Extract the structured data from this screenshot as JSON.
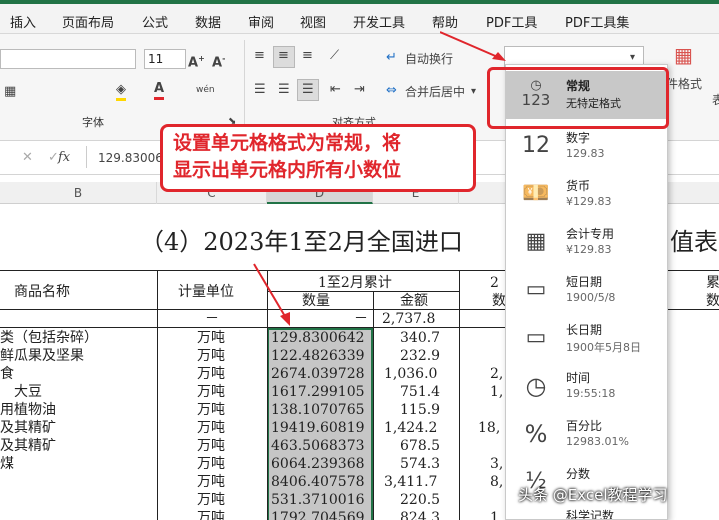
{
  "ribbon_tabs": [
    "插入",
    "页面布局",
    "公式",
    "数据",
    "审阅",
    "视图",
    "开发工具",
    "帮助",
    "PDF工具",
    "PDF工具集"
  ],
  "ribbon": {
    "font_size": "11",
    "wrap_text": "自动换行",
    "merge_center": "合并后居中",
    "font_group": "字体",
    "align_group": "对齐方式",
    "cond_format": "件格式",
    "format_box_value": ""
  },
  "formula_bar": {
    "cell_value": "129.8300642",
    "fx": "fx"
  },
  "column_headers": [
    "B",
    "C",
    "D",
    "E"
  ],
  "callout_lines": [
    "设置单元格格式为常规，将",
    "显示出单元格内所有小数位"
  ],
  "sheet": {
    "title": "（4）2023年1至2月全国进口",
    "title_tail": "值表",
    "header_product": "商品名称",
    "header_unit": "计量单位",
    "header_period": "1至2月累计",
    "header_qty": "数量",
    "header_amount": "金额",
    "header_extra": "2",
    "header_extra2": "数",
    "header_far": "累",
    "header_far2": "数",
    "summary_unit": "－",
    "summary_qty": "－",
    "summary_amount": "2,737.8",
    "rows": [
      {
        "name": "类（包括杂碎）",
        "unit": "万吨",
        "qty": "129.8300642",
        "amount": "340.7",
        "extra": ""
      },
      {
        "name": "鲜瓜果及坚果",
        "unit": "万吨",
        "qty": "122.4826339",
        "amount": "232.9",
        "extra": ""
      },
      {
        "name": "食",
        "unit": "万吨",
        "qty": "2674.039728",
        "amount": "1,036.0",
        "extra": "2,"
      },
      {
        "name": "　大豆",
        "unit": "万吨",
        "qty": "1617.299105",
        "amount": "751.4",
        "extra": "1,"
      },
      {
        "name": "用植物油",
        "unit": "万吨",
        "qty": "138.1070765",
        "amount": "115.9",
        "extra": ""
      },
      {
        "name": "及其精矿",
        "unit": "万吨",
        "qty": "19419.60819",
        "amount": "1,424.2",
        "extra": "18,"
      },
      {
        "name": "及其精矿",
        "unit": "万吨",
        "qty": "463.5068373",
        "amount": "678.5",
        "extra": ""
      },
      {
        "name": "煤",
        "unit": "万吨",
        "qty": "6064.239368",
        "amount": "574.3",
        "extra": "3,"
      },
      {
        "name": "",
        "unit": "万吨",
        "qty": "8406.407578",
        "amount": "3,411.7",
        "extra": "8,"
      },
      {
        "name": "",
        "unit": "万吨",
        "qty": "531.3710016",
        "amount": "220.5",
        "extra": ""
      },
      {
        "name": "",
        "unit": "万吨",
        "qty": "1792.704569",
        "amount": "824.3",
        "extra": "1,"
      }
    ]
  },
  "format_menu": [
    {
      "name": "常规",
      "value": "无特定格式",
      "icon": "general-123-icon"
    },
    {
      "name": "数字",
      "value": "129.83",
      "icon": "number-12-icon"
    },
    {
      "name": "货币",
      "value": "¥129.83",
      "icon": "currency-icon"
    },
    {
      "name": "会计专用",
      "value": "¥129.83",
      "icon": "accounting-icon"
    },
    {
      "name": "短日期",
      "value": "1900/5/8",
      "icon": "calendar-icon"
    },
    {
      "name": "长日期",
      "value": "1900年5月8日",
      "icon": "calendar-icon"
    },
    {
      "name": "时间",
      "value": "19:55:18",
      "icon": "clock-icon"
    },
    {
      "name": "百分比",
      "value": "12983.01%",
      "icon": "percent-icon"
    },
    {
      "name": "分数",
      "value": "",
      "icon": "fraction-icon"
    },
    {
      "name": "科学记数",
      "value": "",
      "icon": "scientific-icon"
    }
  ],
  "watermark": "头条 @Excel教程学习",
  "colors": {
    "accent_red": "#e0262c",
    "excel_green": "#217346",
    "selection_gray": "#c6c6c6"
  }
}
